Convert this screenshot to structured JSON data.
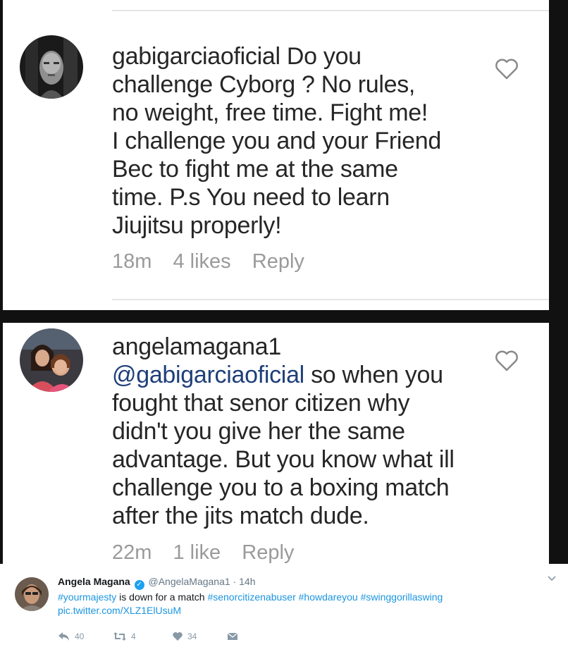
{
  "comments": [
    {
      "username": "gabigarciaoficial",
      "lines": [
        " Do you",
        "challenge Cyborg ? No rules,",
        "no weight, free time. Fight me!",
        "I challenge you and your Friend",
        "Bec to fight me at the same",
        "time. P.s You need to learn",
        "Jiujitsu properly!"
      ],
      "time": "18m",
      "likes": "4 likes",
      "reply": "Reply",
      "avatar_icon": "profile-photo-gabigarcia",
      "like_icon": "heart-outline-icon"
    },
    {
      "username": "angelamagana1",
      "mention": "@gabigarciaoficial",
      "lines": [
        " so when you",
        "fought that senor citizen why",
        "didn't you give her the same",
        "advantage. But you know what ill",
        "challenge you to a boxing match",
        "after the jits match dude."
      ],
      "time": "22m",
      "likes": "1 like",
      "reply": "Reply",
      "avatar_icon": "profile-photo-angelamagana",
      "like_icon": "heart-outline-icon"
    }
  ],
  "tweet": {
    "name": "Angela Magana",
    "handle": "@AngelaMagana1",
    "separator": "·",
    "time": "14h",
    "hashtag1": "#yourmajesty",
    "text_mid": " is down for a match ",
    "hashtag2": "#senorcitizenabuser",
    "hashtag3": "#howdareyou",
    "hashtag4": "#swinggorillaswing",
    "link": "pic.twitter.com/XLZ1ElUsuM",
    "reply_count": "40",
    "retweet_count": "4",
    "like_count": "34",
    "verified_icon": "check-icon"
  },
  "colors": {
    "ig_text": "#262626",
    "ig_meta": "#9a9a9a",
    "mention": "#1f3f7a",
    "twitter_blue": "#1b95e0",
    "twitter_gray": "#657786",
    "frame": "#111111"
  }
}
